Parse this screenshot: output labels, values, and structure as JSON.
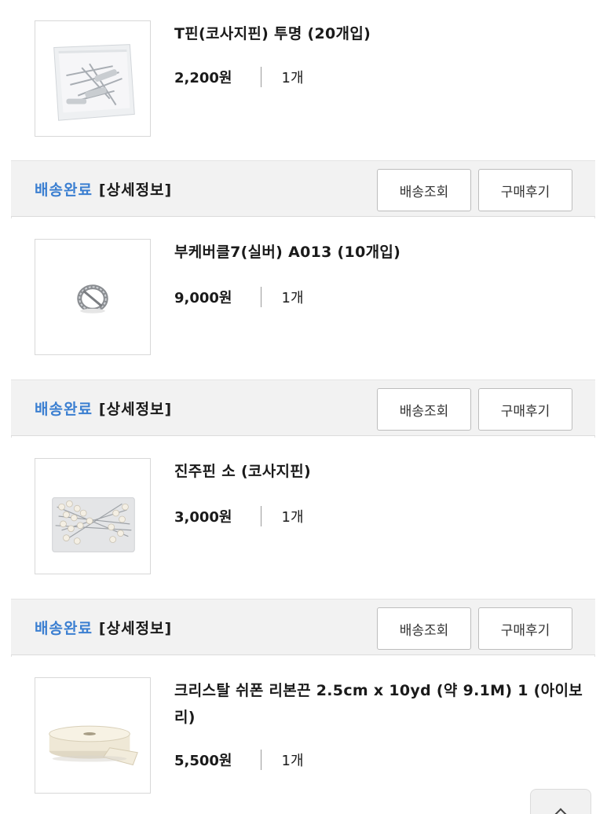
{
  "orders": [
    {
      "name": "T핀(코사지핀) 투명 (20개입)",
      "price": "2,200원",
      "qty": "1개",
      "thumb_icon": "clear-pin-bag-image"
    },
    {
      "name": "부케버클7(실버) A013 (10개입)",
      "price": "9,000원",
      "qty": "1개",
      "thumb_icon": "silver-buckle-image"
    },
    {
      "name": "진주핀 소 (코사지핀)",
      "price": "3,000원",
      "qty": "1개",
      "thumb_icon": "pearl-pin-pack-image"
    },
    {
      "name": "크리스탈 쉬폰 리본끈 2.5cm x 10yd (약 9.1M) 1 (아이보리)",
      "price": "5,500원",
      "qty": "1개",
      "thumb_icon": "ivory-ribbon-roll-image"
    }
  ],
  "status_bars": [
    {
      "status": "배송완료",
      "detail": "[상세정보]",
      "track_label": "배송조회",
      "review_label": "구매후기"
    },
    {
      "status": "배송완료",
      "detail": "[상세정보]",
      "track_label": "배송조회",
      "review_label": "구매후기"
    },
    {
      "status": "배송완료",
      "detail": "[상세정보]",
      "track_label": "배송조회",
      "review_label": "구매후기"
    }
  ],
  "colors": {
    "status_blue": "#3b7fd1",
    "bar_bg": "#f2f2f2"
  }
}
